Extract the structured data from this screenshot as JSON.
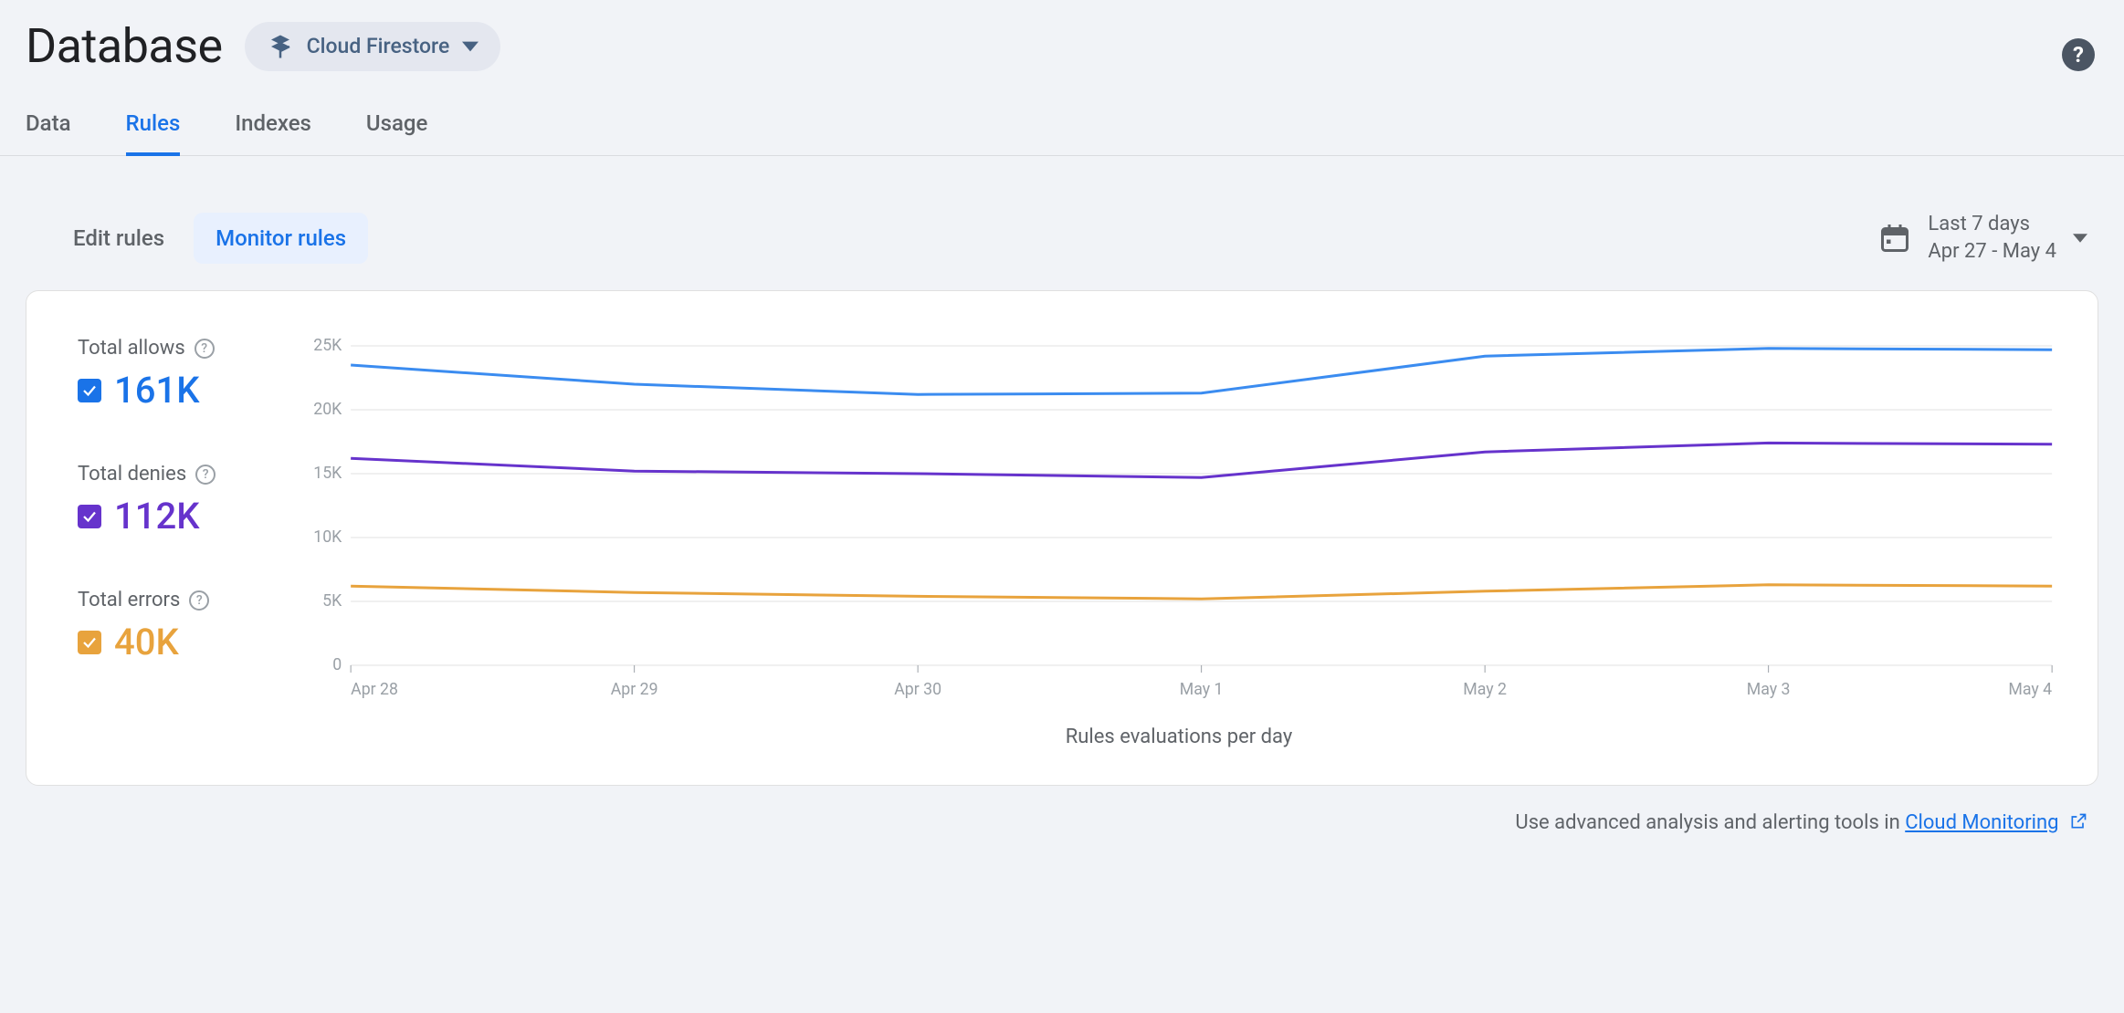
{
  "header": {
    "title": "Database",
    "selector_label": "Cloud Firestore"
  },
  "tabs": [
    {
      "label": "Data",
      "active": false
    },
    {
      "label": "Rules",
      "active": true
    },
    {
      "label": "Indexes",
      "active": false
    },
    {
      "label": "Usage",
      "active": false
    }
  ],
  "subtabs": [
    {
      "label": "Edit rules",
      "active": false
    },
    {
      "label": "Monitor rules",
      "active": true
    }
  ],
  "date_range": {
    "line1": "Last 7 days",
    "line2": "Apr 27 - May 4"
  },
  "legend": {
    "allows": {
      "label": "Total allows",
      "value": "161K",
      "color": "#1a73e8"
    },
    "denies": {
      "label": "Total denies",
      "value": "112K",
      "color": "#6633cc"
    },
    "errors": {
      "label": "Total errors",
      "value": "40K",
      "color": "#e8a33d"
    }
  },
  "chart_data": {
    "type": "line",
    "xlabel": "Rules evaluations per day",
    "ylabel": "",
    "categories": [
      "Apr 28",
      "Apr 29",
      "Apr 30",
      "May 1",
      "May 2",
      "May 3",
      "May 4"
    ],
    "y_ticks": [
      0,
      5000,
      10000,
      15000,
      20000,
      25000
    ],
    "y_tick_labels": [
      "0",
      "5K",
      "10K",
      "15K",
      "20K",
      "25K"
    ],
    "ylim": [
      0,
      26000
    ],
    "series": [
      {
        "name": "Total allows",
        "color": "#3b8cf0",
        "values": [
          23500,
          22000,
          21200,
          21300,
          24200,
          24800,
          24700
        ]
      },
      {
        "name": "Total denies",
        "color": "#6633cc",
        "values": [
          16200,
          15200,
          15000,
          14700,
          16700,
          17400,
          17300
        ]
      },
      {
        "name": "Total errors",
        "color": "#e8a33d",
        "values": [
          6200,
          5700,
          5400,
          5200,
          5800,
          6300,
          6200
        ]
      }
    ]
  },
  "footer": {
    "prefix": "Use advanced analysis and alerting tools in ",
    "link_text": "Cloud Monitoring"
  }
}
